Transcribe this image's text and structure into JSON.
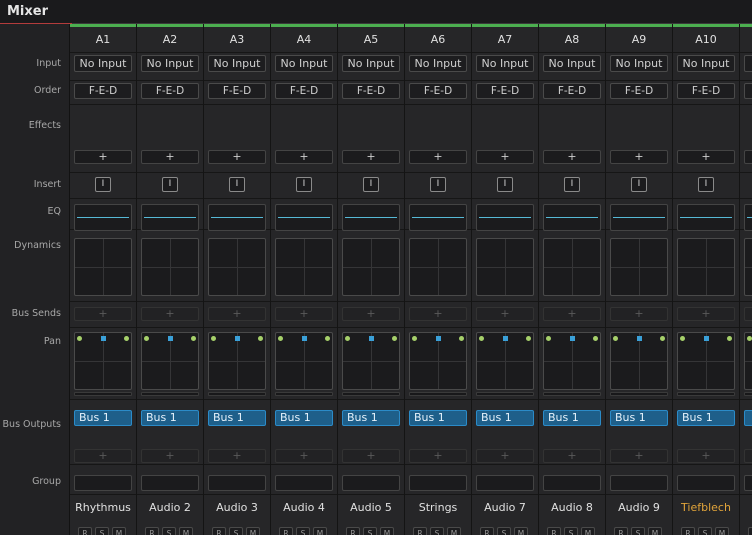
{
  "window": {
    "title": "Mixer"
  },
  "row_labels": {
    "input": "Input",
    "order": "Order",
    "effects": "Effects",
    "insert": "Insert",
    "eq": "EQ",
    "dynamics": "Dynamics",
    "bus_sends": "Bus Sends",
    "pan": "Pan",
    "bus_outputs": "Bus Outputs",
    "group": "Group"
  },
  "strip_common": {
    "effects_add": "+",
    "insert_label": "I",
    "bus_send_add": "+",
    "bus_output_add": "+",
    "record": "R",
    "solo": "S",
    "mute": "M"
  },
  "strips": [
    {
      "id": "A1",
      "input": "No Input",
      "order": "F-E-D",
      "bus_output": "Bus 1",
      "track_name": "Rhythmus"
    },
    {
      "id": "A2",
      "input": "No Input",
      "order": "F-E-D",
      "bus_output": "Bus 1",
      "track_name": "Audio 2"
    },
    {
      "id": "A3",
      "input": "No Input",
      "order": "F-E-D",
      "bus_output": "Bus 1",
      "track_name": "Audio 3"
    },
    {
      "id": "A4",
      "input": "No Input",
      "order": "F-E-D",
      "bus_output": "Bus 1",
      "track_name": "Audio 4"
    },
    {
      "id": "A5",
      "input": "No Input",
      "order": "F-E-D",
      "bus_output": "Bus 1",
      "track_name": "Audio 5"
    },
    {
      "id": "A6",
      "input": "No Input",
      "order": "F-E-D",
      "bus_output": "Bus 1",
      "track_name": "Strings"
    },
    {
      "id": "A7",
      "input": "No Input",
      "order": "F-E-D",
      "bus_output": "Bus 1",
      "track_name": "Audio 7"
    },
    {
      "id": "A8",
      "input": "No Input",
      "order": "F-E-D",
      "bus_output": "Bus 1",
      "track_name": "Audio 8"
    },
    {
      "id": "A9",
      "input": "No Input",
      "order": "F-E-D",
      "bus_output": "Bus 1",
      "track_name": "Audio 9"
    },
    {
      "id": "A10",
      "input": "No Input",
      "order": "F-E-D",
      "bus_output": "Bus 1",
      "track_name": "Tiefblech",
      "name_color": "#e1a43a"
    },
    {
      "id": "",
      "input": "",
      "order": "",
      "bus_output": "",
      "track_name": ""
    }
  ],
  "colors": {
    "strip_top_bar": "#4caf50",
    "bus_output": "#1e5f8a",
    "eq_curve": "#56b9d6",
    "pan_edge_dot": "#a6d06a",
    "pan_center_dot": "#3aa0d8"
  }
}
